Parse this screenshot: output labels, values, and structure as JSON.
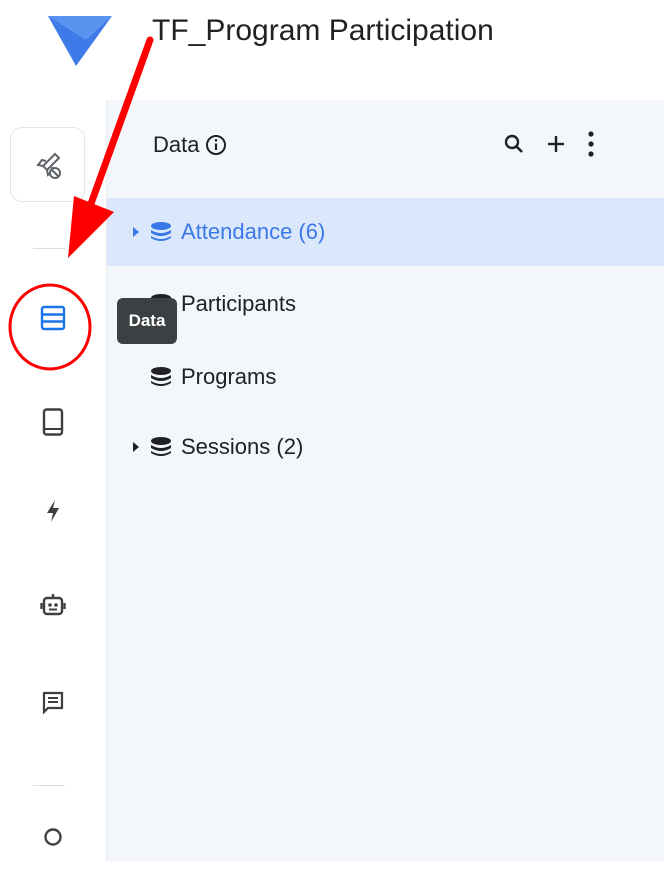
{
  "app": {
    "title": "TF_Program Participation"
  },
  "rail": {
    "items": [
      {
        "name": "launch",
        "icon": "rocket-off-icon"
      },
      {
        "name": "data",
        "icon": "table-rows-icon",
        "selected": true,
        "tooltip": "Data"
      },
      {
        "name": "views",
        "icon": "phone-icon"
      },
      {
        "name": "automation",
        "icon": "bolt-icon"
      },
      {
        "name": "bots",
        "icon": "robot-icon"
      },
      {
        "name": "chat",
        "icon": "message-icon"
      },
      {
        "name": "search",
        "icon": "search-icon"
      }
    ]
  },
  "panel": {
    "title": "Data",
    "tables": [
      {
        "label": "Attendance (6)",
        "expandable": true,
        "selected": true
      },
      {
        "label": "Participants",
        "expandable": false,
        "selected": false
      },
      {
        "label": "Programs",
        "expandable": false,
        "selected": false
      },
      {
        "label": "Sessions (2)",
        "expandable": true,
        "selected": false
      }
    ]
  },
  "tooltip": {
    "text": "Data"
  },
  "colors": {
    "accent": "#1a73e8",
    "selected_bg": "#dbe8fc",
    "panel_bg": "#f3f6fb",
    "annotation": "#ff0000"
  }
}
